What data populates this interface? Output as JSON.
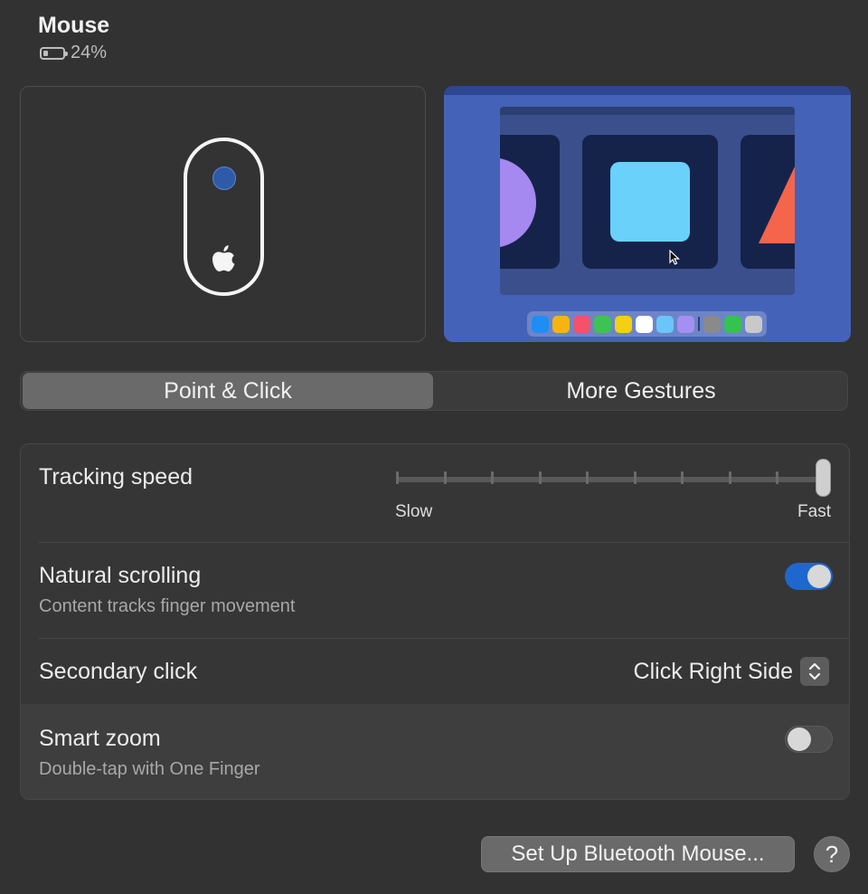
{
  "header": {
    "title": "Mouse",
    "battery_text": "24%",
    "battery_level_fraction": 0.24
  },
  "previews": {
    "mouse_icon": "magic-mouse-icon",
    "logo_icon": "apple-logo-icon",
    "gesture_preview": "mission-control-preview",
    "dock_colors": [
      "#1e8ef5",
      "#f7b411",
      "#f5516a",
      "#3cc353",
      "#f4cf12",
      "#ffffff",
      "#6ac6f8",
      "#a58ff2",
      "#8a8a8a",
      "#36c24f",
      "#c9c9c9"
    ]
  },
  "tabs": [
    {
      "label": "Point & Click",
      "active": true
    },
    {
      "label": "More Gestures",
      "active": false
    }
  ],
  "settings": {
    "tracking_speed": {
      "label": "Tracking speed",
      "min_label": "Slow",
      "max_label": "Fast",
      "ticks": 10,
      "value_fraction": 1.0
    },
    "natural_scrolling": {
      "label": "Natural scrolling",
      "description": "Content tracks finger movement",
      "enabled": true
    },
    "secondary_click": {
      "label": "Secondary click",
      "value": "Click Right Side",
      "icon": "up-down-chevron-icon"
    },
    "smart_zoom": {
      "label": "Smart zoom",
      "description": "Double-tap with One Finger",
      "enabled": false
    }
  },
  "buttons": {
    "bluetooth_setup": "Set Up Bluetooth Mouse...",
    "help": "?"
  },
  "colors": {
    "accent": "#1e67cf",
    "background": "#323232"
  }
}
